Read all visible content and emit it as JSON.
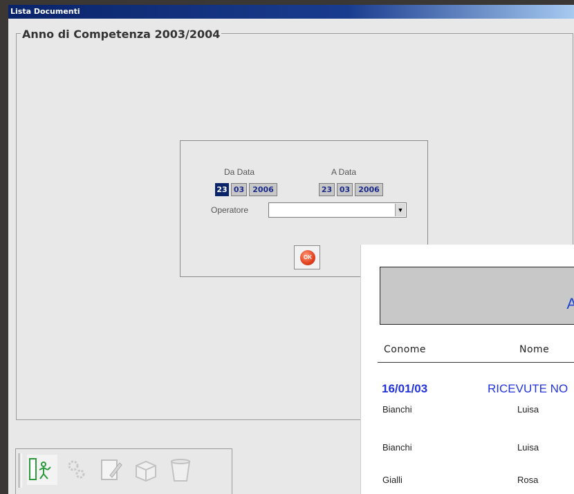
{
  "window": {
    "title": "Lista Documenti"
  },
  "group": {
    "title": "Anno di Competenza 2003/2004"
  },
  "filter": {
    "from_label": "Da Data",
    "to_label": "A Data",
    "from_date": {
      "day": "23",
      "month": "03",
      "year": "2006"
    },
    "to_date": {
      "day": "23",
      "month": "03",
      "year": "2006"
    },
    "operator_label": "Operatore",
    "operator_value": "",
    "ok_label": "OK"
  },
  "toolbar": {
    "buttons": [
      {
        "name": "new-document",
        "state": "enabled"
      },
      {
        "name": "settings",
        "state": "disabled"
      },
      {
        "name": "edit",
        "state": "disabled"
      },
      {
        "name": "archive",
        "state": "disabled"
      },
      {
        "name": "delete",
        "state": "disabled"
      }
    ]
  },
  "report": {
    "header_mark": "A",
    "columns": [
      "Conome",
      "Nome"
    ],
    "group_date": "16/01/03",
    "group_title": "RICEVUTE NO",
    "rows": [
      {
        "cognome": "Bianchi",
        "nome": "Luisa"
      },
      {
        "cognome": "Bianchi",
        "nome": "Luisa"
      },
      {
        "cognome": "Gialli",
        "nome": "Rosa"
      }
    ]
  }
}
